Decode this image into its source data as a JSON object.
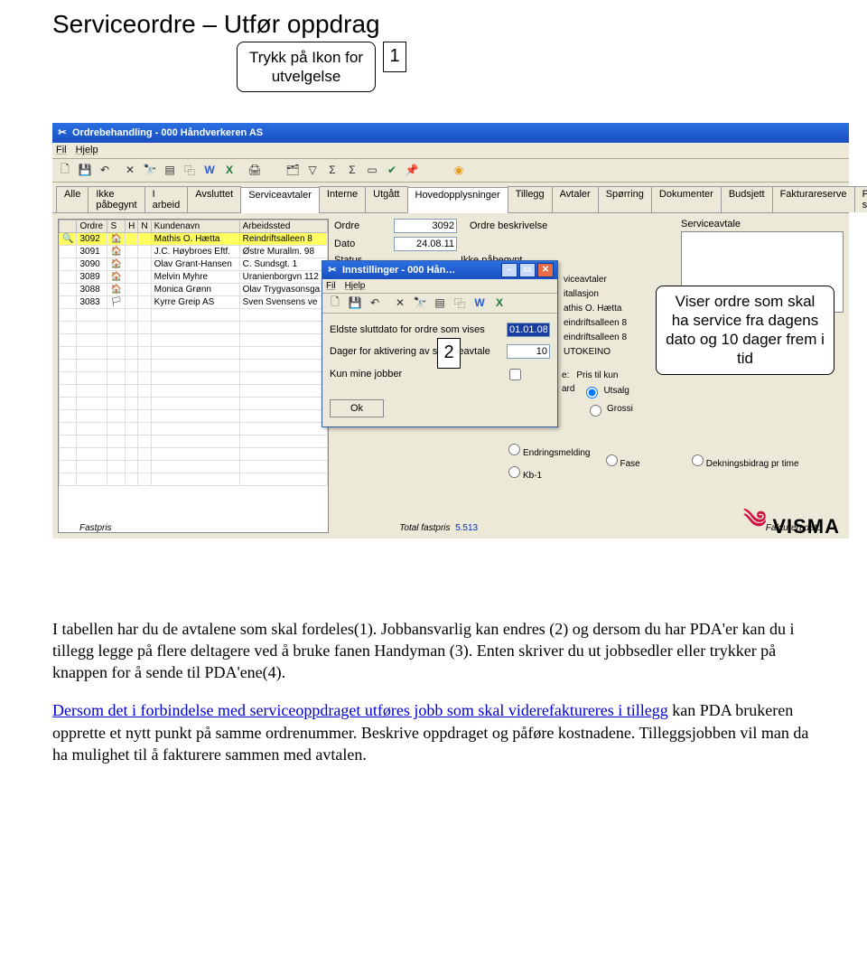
{
  "title": "Serviceordre – Utfør oppdrag",
  "callouts": {
    "c1": "Trykk på Ikon for utvelgelse",
    "n1": "1",
    "n2": "2",
    "c2": "Viser ordre som skal ha service fra dagens dato og 10 dager frem i tid"
  },
  "window": {
    "title": "Ordrebehandling - 000 Håndverkeren AS",
    "icon": "wrench-icon",
    "menus": [
      "Fil",
      "Hjelp"
    ]
  },
  "tabs": [
    "Alle",
    "Ikke påbegynt",
    "I arbeid",
    "Avsluttet",
    "Serviceavtaler",
    "Interne",
    "Utgått"
  ],
  "active_tab": "Serviceavtaler",
  "right_tabs": [
    "Hovedopplysninger",
    "Tillegg",
    "Avtaler",
    "Spørring",
    "Dokumenter",
    "Budsjett",
    "Fakturareserve",
    "Priser service"
  ],
  "grid": {
    "headers": [
      "",
      "Ordre",
      "S",
      "H",
      "N",
      "Kundenavn",
      "Arbeidssted"
    ],
    "rows": [
      {
        "p": "🔍",
        "ordre": "3092",
        "s": "🏠",
        "h": "",
        "n": "",
        "kunde": "Mathis O. Hætta",
        "arb": "Reindriftsalleen 8",
        "sel": true
      },
      {
        "p": "",
        "ordre": "3091",
        "s": "🏠",
        "h": "",
        "n": "",
        "kunde": "J.C. Høybroes Eftf.",
        "arb": "Østre Murallm. 98"
      },
      {
        "p": "",
        "ordre": "3090",
        "s": "🏠",
        "h": "",
        "n": "",
        "kunde": "Olav Grant-Hansen",
        "arb": "C. Sundsgt. 1"
      },
      {
        "p": "",
        "ordre": "3089",
        "s": "🏠",
        "h": "",
        "n": "",
        "kunde": "Melvin Myhre",
        "arb": "Uranienborgvn 112"
      },
      {
        "p": "",
        "ordre": "3088",
        "s": "🏠",
        "h": "",
        "n": "",
        "kunde": "Monica Grønn",
        "arb": "Olav Trygvasonsga"
      },
      {
        "p": "",
        "ordre": "3083",
        "s": "🏳",
        "h": "",
        "n": "",
        "kunde": "Kyrre Greip AS",
        "arb": "Sven Svensens ve"
      }
    ]
  },
  "detail": {
    "ordre_label": "Ordre",
    "ordre_value": "3092",
    "dato_label": "Dato",
    "dato_value": "24.08.11",
    "status_label": "Status",
    "status_value": "Ikke påbegynt",
    "ordre_beskr": "Ordre beskrivelse",
    "serviceavtale": "Serviceavtale"
  },
  "dialog": {
    "title": "Innstillinger - 000 Hån…",
    "menus": [
      "Fil",
      "Hjelp"
    ],
    "f1_label": "Eldste sluttdato for ordre som vises",
    "f1_value": "01.01.08",
    "f2_label": "Dager for aktivering av serviceavtale",
    "f2_value": "10",
    "f3_label": "Kun mine jobber",
    "ok": "Ok"
  },
  "side_readout": {
    "l1": "viceavtaler",
    "l2": "itallasjon",
    "l3": "athis O. Hætta",
    "l4": "eindriftsalleen 8",
    "l5": "eindriftsalleen 8",
    "l6": "UTOKEINO",
    "row_label": "e:",
    "pris_label": "Pris til kun",
    "ard": "ard",
    "opt_utsalg": "Utsalg",
    "opt_grossi": "Grossi"
  },
  "radio_row2": {
    "c1a": "Endringsmelding",
    "c1b": "Kb-1",
    "c2a": "Fase",
    "c3a": "Dekningsbidrag pr time"
  },
  "bottom": {
    "fastpris": "Fastpris",
    "total_fp": "Total fastpris",
    "total_val": "5.513",
    "fakturert": "Fakturert dato"
  },
  "logo_text": "VISMA",
  "paragraph": {
    "p1": "I tabellen har du de avtalene som skal fordeles(1). Jobbansvarlig kan endres (2) og dersom du har PDA'er kan du i tillegg legge på flere deltagere ved å bruke fanen  Handyman (3). Enten skriver du ut jobbsedler eller trykker på knappen for å sende til PDA'ene(4).",
    "p2a": "Dersom det i forbindelse med serviceoppdraget utføres jobb som skal viderefaktureres i tillegg",
    "p2b": " kan PDA brukeren opprette et nytt punkt på samme ordrenummer. Beskrive oppdraget og påføre kostnadene. Tilleggsjobben vil man da ha mulighet til å fakturere sammen med avtalen."
  }
}
